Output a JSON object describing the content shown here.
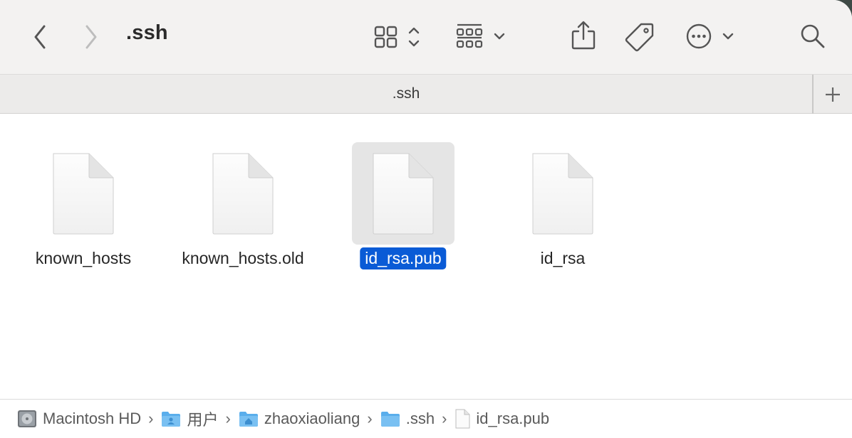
{
  "window": {
    "title": ".ssh",
    "tab_title": ".ssh"
  },
  "toolbar": {
    "back_icon": "chevron-left-icon",
    "forward_icon": "chevron-right-icon",
    "view_icon": "icon-grid-view-icon",
    "group_icon": "group-by-icon",
    "share_icon": "share-icon",
    "tag_icon": "tag-icon",
    "more_icon": "ellipsis-circle-icon",
    "search_icon": "search-icon",
    "tab_add_icon": "plus-icon"
  },
  "files": [
    {
      "name": "known_hosts",
      "selected": false
    },
    {
      "name": "known_hosts.old",
      "selected": false
    },
    {
      "name": "id_rsa.pub",
      "selected": true
    },
    {
      "name": "id_rsa",
      "selected": false
    }
  ],
  "path": [
    {
      "label": "Macintosh HD",
      "icon": "hard-drive-icon"
    },
    {
      "label": "用户",
      "icon": "users-folder-icon"
    },
    {
      "label": "zhaoxiaoliang",
      "icon": "home-folder-icon"
    },
    {
      "label": ".ssh",
      "icon": "folder-icon"
    },
    {
      "label": "id_rsa.pub",
      "icon": "document-icon"
    }
  ],
  "colors": {
    "selection": "#0a5bd6",
    "folder": "#5aaeec",
    "toolbar_bg": "#f3f2f1"
  }
}
